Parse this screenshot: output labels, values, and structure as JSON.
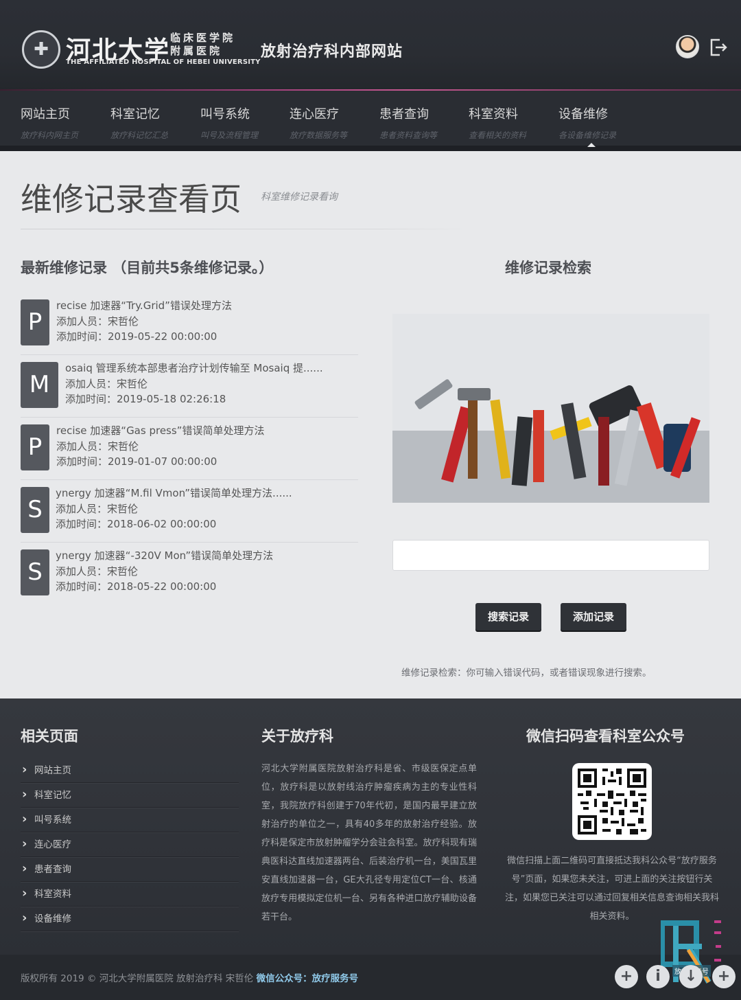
{
  "header": {
    "logo_cn": "河北大学",
    "logo_sub": "临床医学院附属医院",
    "logo_en": "THE AFFILIATED HOSPITAL OF HEBEI UNIVERSITY",
    "site_name": "放射治疗科内部网站"
  },
  "nav": [
    {
      "title": "网站主页",
      "sub": "放疗科内网主页"
    },
    {
      "title": "科室记忆",
      "sub": "放疗科记忆汇总"
    },
    {
      "title": "叫号系统",
      "sub": "叫号及流程管理"
    },
    {
      "title": "连心医疗",
      "sub": "放疗数据服务等"
    },
    {
      "title": "患者查询",
      "sub": "患者资料查询等"
    },
    {
      "title": "科室资料",
      "sub": "查看相关的资料"
    },
    {
      "title": "设备维修",
      "sub": "各设备维修记录"
    }
  ],
  "page": {
    "title": "维修记录查看页",
    "subtitle": "科室维修记录看询"
  },
  "records_section": {
    "heading": "最新维修记录 （目前共5条维修记录。）",
    "items": [
      {
        "letter": "P",
        "title": "recise 加速器“Try.Grid”错误处理方法",
        "adder": "添加人员：宋哲伦",
        "time": "添加时间：2019-05-22 00:00:00"
      },
      {
        "letter": "M",
        "title": "osaiq 管理系统本部患者治疗计划传输至 Mosaiq 提......",
        "adder": "添加人员：宋哲伦",
        "time": "添加时间：2019-05-18 02:26:18"
      },
      {
        "letter": "P",
        "title": "recise 加速器“Gas press”错误简单处理方法",
        "adder": "添加人员：宋哲伦",
        "time": "添加时间：2019-01-07 00:00:00"
      },
      {
        "letter": "S",
        "title": "ynergy 加速器“M.fil Vmon”错误简单处理方法......",
        "adder": "添加人员：宋哲伦",
        "time": "添加时间：2018-06-02 00:00:00"
      },
      {
        "letter": "S",
        "title": "ynergy 加速器“-320V Mon”错误简单处理方法",
        "adder": "添加人员：宋哲伦",
        "time": "添加时间：2018-05-22 00:00:00"
      }
    ]
  },
  "search": {
    "heading": "维修记录检索",
    "placeholder": "",
    "search_btn": "搜索记录",
    "add_btn": "添加记录",
    "hint": "维修记录检索：你可输入错误代码，或者错误现象进行搜索。"
  },
  "footer": {
    "links_heading": "相关页面",
    "links": [
      "网站主页",
      "科室记忆",
      "叫号系统",
      "连心医疗",
      "患者查询",
      "科室资料",
      "设备维修"
    ],
    "about_heading": "关于放疗科",
    "about_text": "河北大学附属医院放射治疗科是省、市级医保定点单位，放疗科是以放射线治疗肿瘤疾病为主的专业性科室，我院放疗科创建于70年代初，是国内最早建立放射治疗的单位之一，具有40多年的放射治疗经验。放疗科是保定市放射肿瘤学分会驻会科室。放疗科现有瑞典医科达直线加速器两台、后装治疗机一台，美国瓦里安直线加速器一台，GE大孔径专用定位CT一台、核通放疗专用模拟定位机一台、另有各种进口放疗辅助设备若干台。",
    "wechat_heading": "微信扫码查看科室公众号",
    "wechat_text": "微信扫描上面二维码可直接抵达我科公众号“放疗服务号”页面，如果您未关注，可进上面的关注按钮行关注，如果您已关注可以通过回复相关信息查询相关我科相关资料。",
    "copyright_prefix": "版权所有 2019 © 河北大学附属医院 放射治疗科 宋哲伦",
    "copyright_wechat": "微信公众号：放疗服务号",
    "watermark": "放疗服务号"
  },
  "colors": {
    "header_bg": "#2a2d33",
    "accent_line": "#c45890",
    "badge_bg": "#55585e",
    "link_highlight": "#8fc8e8"
  }
}
